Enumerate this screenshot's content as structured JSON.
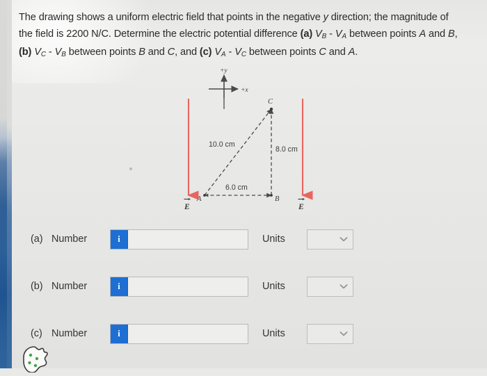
{
  "problem": {
    "line1_a": "The drawing shows a uniform electric field that points in the negative ",
    "line1_y": "y",
    "line1_b": " direction; the magnitude of",
    "line2_a": "the field is 2200 N/C. Determine the electric potential difference ",
    "line2_label_a": "(a)",
    "line2_vb": "V",
    "line2_vb_sub": "B",
    "line2_minus": " - ",
    "line2_va": "V",
    "line2_va_sub": "A",
    "line2_tail": " between points ",
    "line2_pt1": "A",
    "line2_and": " and ",
    "line2_pt2": "B",
    "line2_end": ",",
    "line3_label_b": "(b)",
    "line3_vc": "V",
    "line3_vc_sub": "C",
    "line3_vb": "V",
    "line3_vb_sub": "B",
    "line3_mid": " between points ",
    "line3_pt1": "B",
    "line3_and": " and ",
    "line3_pt2": "C",
    "line3_comma": ", and ",
    "line3_label_c": "(c)",
    "line3_va": "V",
    "line3_va_sub": "A",
    "line3_vc2": "V",
    "line3_vc2_sub": "C",
    "line3_tail": " between points ",
    "line3_pt3": "C",
    "line3_and2": " and ",
    "line3_pt4": "A",
    "line3_end": "."
  },
  "figure": {
    "axis_y_label": "+y",
    "axis_x_label": "+x",
    "point_a": "A",
    "point_b": "B",
    "point_c": "C",
    "hypotenuse_label": "10.0 cm",
    "base_label": "6.0 cm",
    "height_label": "8.0 cm",
    "field_label_left": "E",
    "field_label_right": "E",
    "field_arrow_color": "#e8655f",
    "line_color": "#4a4a4a"
  },
  "answers": {
    "units_caption": "Units",
    "number_caption": "Number",
    "info_glyph": "i",
    "accent_blue": "#1d6fd4",
    "rows": [
      {
        "letter": "(a)",
        "number_value": "",
        "number_placeholder": "",
        "units_value": ""
      },
      {
        "letter": "(b)",
        "number_value": "",
        "number_placeholder": "",
        "units_value": ""
      },
      {
        "letter": "(c)",
        "number_value": "",
        "number_placeholder": "",
        "units_value": ""
      }
    ]
  },
  "overlay": {
    "cookie_icon_name": "cookie-consent-icon",
    "cookie_dot_color": "#3aa84a"
  }
}
